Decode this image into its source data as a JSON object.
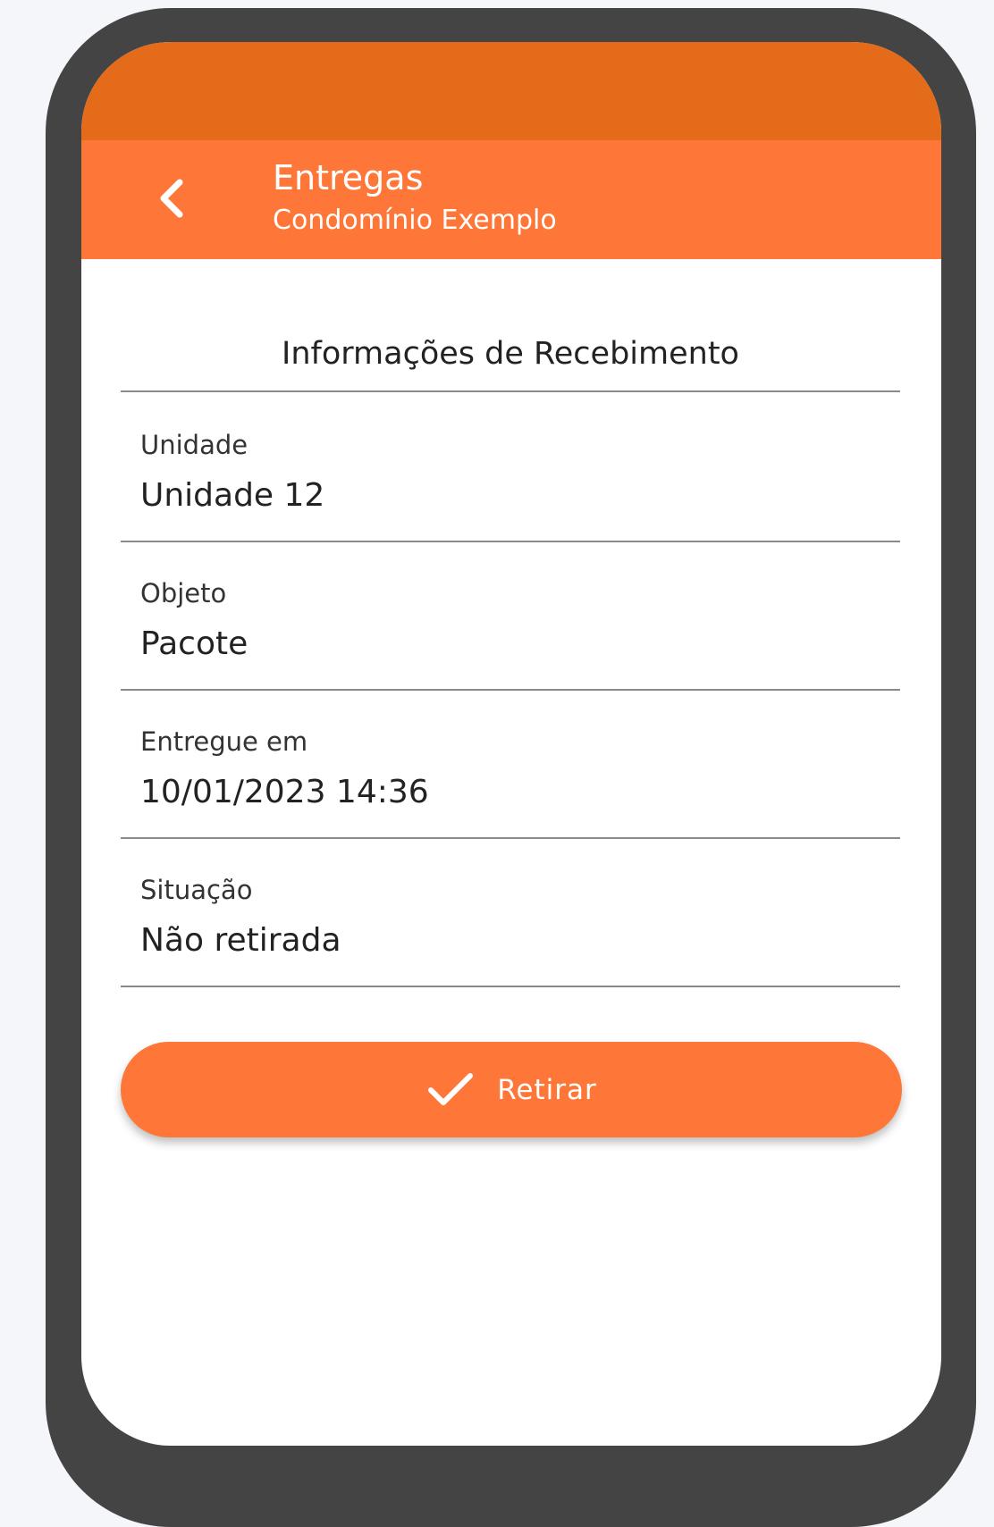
{
  "colors": {
    "frame": "#444444",
    "status_bar": "#e46b19",
    "accent": "#fe7739",
    "screen_bg": "#ffffff",
    "divider": "#8a8a8a",
    "text": "#222222"
  },
  "header": {
    "back_icon": "chevron-left-icon",
    "title": "Entregas",
    "subtitle": "Condomínio Exemplo"
  },
  "details": {
    "section_title": "Informações de Recebimento",
    "fields": [
      {
        "label": "Unidade",
        "value": "Unidade 12"
      },
      {
        "label": "Objeto",
        "value": "Pacote"
      },
      {
        "label": "Entregue em",
        "value": "10/01/2023 14:36"
      },
      {
        "label": "Situação",
        "value": "Não retirada"
      }
    ]
  },
  "action": {
    "icon": "check-icon",
    "label": "Retirar"
  }
}
